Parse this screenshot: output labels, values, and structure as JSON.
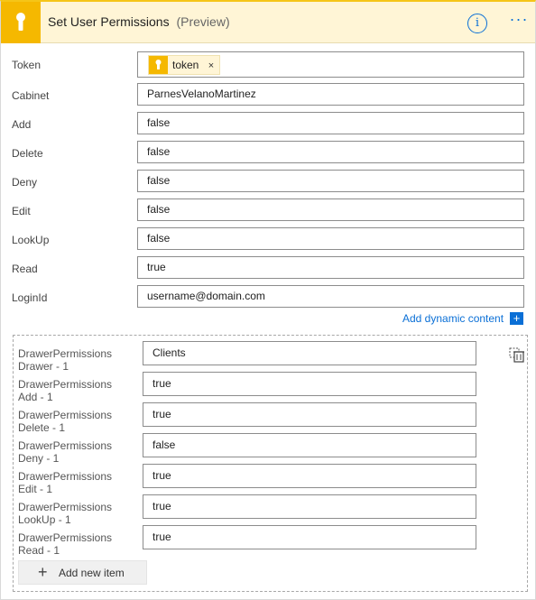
{
  "header": {
    "title": "Set User Permissions",
    "preview_tag": "(Preview)",
    "info_glyph": "i",
    "more_glyph": "···",
    "icon": "keyhole-icon",
    "accent_color": "#f5b800",
    "header_bg": "#fff5d6"
  },
  "form": {
    "token": {
      "label": "Token",
      "chip_text": "token",
      "chip_remove": "×"
    },
    "fields": [
      {
        "label": "Cabinet",
        "value": "ParnesVelanoMartinez"
      },
      {
        "label": "Add",
        "value": "false"
      },
      {
        "label": "Delete",
        "value": "false"
      },
      {
        "label": "Deny",
        "value": "false"
      },
      {
        "label": "Edit",
        "value": "false"
      },
      {
        "label": "LookUp",
        "value": "false"
      },
      {
        "label": "Read",
        "value": "true"
      },
      {
        "label": "LoginId",
        "value": "username@domain.com"
      }
    ],
    "dynamic_content_link": "Add dynamic content",
    "dynamic_content_plus": "+"
  },
  "drawer_permissions": {
    "items": [
      {
        "label_line1": "DrawerPermissions",
        "label_line2": "Drawer - 1",
        "value": "Clients"
      },
      {
        "label_line1": "DrawerPermissions",
        "label_line2": "Add - 1",
        "value": "true"
      },
      {
        "label_line1": "DrawerPermissions",
        "label_line2": "Delete - 1",
        "value": "true"
      },
      {
        "label_line1": "DrawerPermissions",
        "label_line2": "Deny - 1",
        "value": "false"
      },
      {
        "label_line1": "DrawerPermissions",
        "label_line2": "Edit - 1",
        "value": "true"
      },
      {
        "label_line1": "DrawerPermissions",
        "label_line2": "LookUp - 1",
        "value": "true"
      },
      {
        "label_line1": "DrawerPermissions",
        "label_line2": "Read - 1",
        "value": "true"
      }
    ],
    "add_item_label": "Add new item",
    "add_item_plus": "+"
  }
}
